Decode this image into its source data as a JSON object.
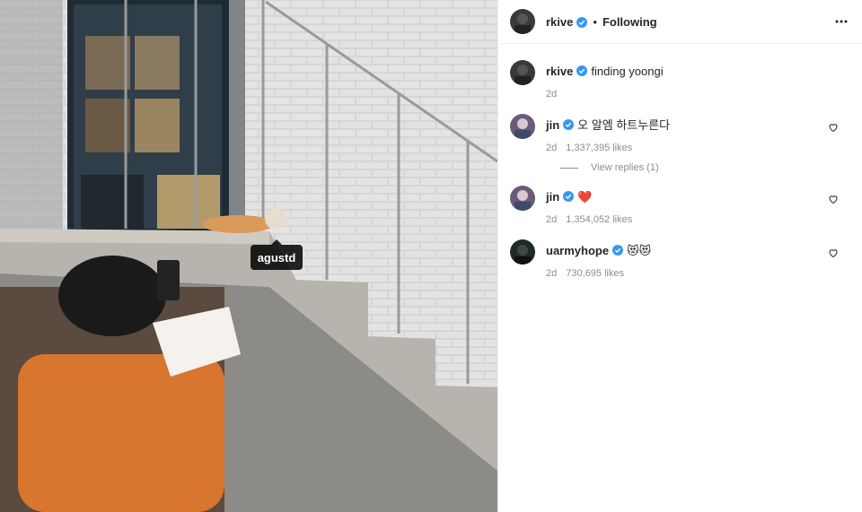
{
  "photo": {
    "tag_label": "agustd",
    "icon": "photo-of-person-photographing-cat-on-stairs"
  },
  "header": {
    "username": "rkive",
    "separator": "•",
    "follow_status": "Following",
    "more_icon": "more-horizontal-icon"
  },
  "caption": {
    "username": "rkive",
    "text": "finding yoongi",
    "time": "2d"
  },
  "comments": [
    {
      "username": "jin",
      "text": "오 알엠 하트누른다",
      "time": "2d",
      "likes": "1,337,395 likes",
      "replies": "View replies (1)"
    },
    {
      "username": "jin",
      "text": "❤️",
      "time": "2d",
      "likes": "1,354,052 likes"
    },
    {
      "username": "uarmyhope",
      "text": "😻😻",
      "time": "2d",
      "likes": "730,695 likes"
    }
  ],
  "colors": {
    "verified": "#3897f0",
    "muted": "#8e8e8e",
    "heart_emoji": "#ed4956"
  }
}
